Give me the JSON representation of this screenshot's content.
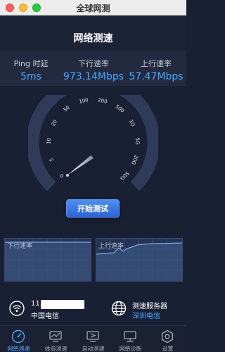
{
  "window": {
    "title": "全球网测"
  },
  "header": {
    "title": "网络测速"
  },
  "stats": {
    "ping": {
      "label": "Ping 时延",
      "value": "5ms"
    },
    "download": {
      "label": "下行速率",
      "value": "973.14Mbps"
    },
    "upload": {
      "label": "上行速率",
      "value": "57.47Mbps"
    }
  },
  "gauge": {
    "ticks": [
      "0",
      "5",
      "10",
      "20",
      "50",
      "100",
      "200",
      "500",
      "1G",
      "5G",
      "20G",
      "50G"
    ],
    "needle_value": "1"
  },
  "start_button": {
    "label": "开始测试"
  },
  "charts": {
    "download_label": "下行速率",
    "upload_label": "上行速率"
  },
  "network": {
    "ip": "11.",
    "isp": "中国电信"
  },
  "server": {
    "label": "测速服务器",
    "name": "深圳电信"
  },
  "tabs": [
    {
      "label": "网络测速",
      "icon": "speedometer-icon",
      "active": true
    },
    {
      "label": "体验测速",
      "icon": "experience-icon",
      "active": false
    },
    {
      "label": "自动测速",
      "icon": "auto-test-icon",
      "active": false
    },
    {
      "label": "网络诊断",
      "icon": "diagnosis-icon",
      "active": false
    },
    {
      "label": "设置",
      "icon": "settings-icon",
      "active": false
    }
  ],
  "colors": {
    "accent": "#4aa8ff",
    "background": "#1a2034",
    "gauge_track": "#2f3b59"
  }
}
